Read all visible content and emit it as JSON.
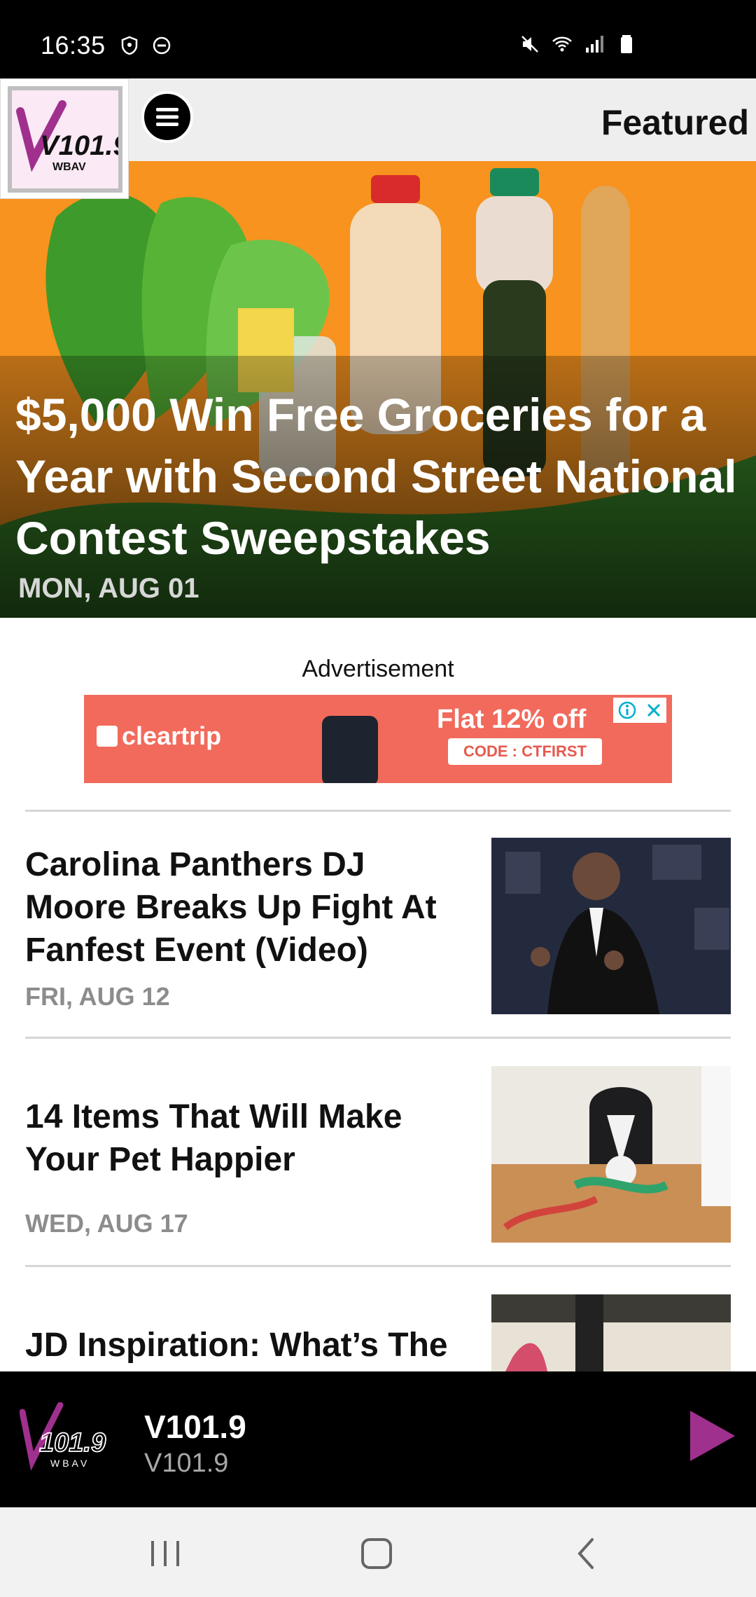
{
  "status_bar": {
    "time": "16:35"
  },
  "header": {
    "logo_text": "V101.9",
    "logo_subtext": "WBAV",
    "section_title": "Featured"
  },
  "hero": {
    "title": "$5,000 Win Free Groceries for a Year with Second Street National Contest Sweepstakes",
    "date": "MON, AUG 01"
  },
  "ad": {
    "label": "Advertisement",
    "brand": "cleartrip",
    "offer": "Flat 12% off",
    "code": "CODE : CTFIRST"
  },
  "articles": [
    {
      "title": "Carolina Panthers DJ Moore Breaks Up Fight At Fanfest Event (Video)",
      "date": "FRI, AUG 12"
    },
    {
      "title": "14 Items That Will Make Your Pet Happier",
      "date": "WED, AUG 17"
    },
    {
      "title": "JD Inspiration:  What’s The",
      "date": ""
    }
  ],
  "player": {
    "station_name": "V101.9",
    "station_sub": "V101.9"
  },
  "colors": {
    "accent": "#a0308e",
    "hero_bg": "#f7931e",
    "ad_bg": "#f16a5c"
  },
  "icons": {
    "menu": "hamburger-menu-icon",
    "play": "play-icon",
    "nav_recent": "recent-apps-icon",
    "nav_home": "home-icon",
    "nav_back": "back-icon"
  }
}
